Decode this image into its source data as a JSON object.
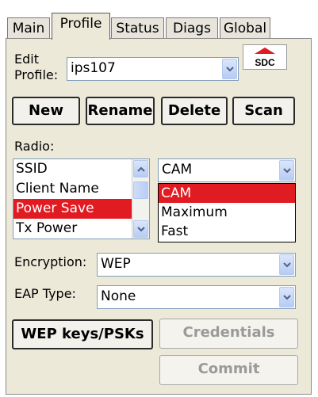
{
  "tabs": [
    "Main",
    "Profile",
    "Status",
    "Diags",
    "Global"
  ],
  "active_tab": "Profile",
  "edit_profile": {
    "label_line1": "Edit",
    "label_line2": "Profile:",
    "value": "ips107"
  },
  "logo": {
    "text": "SDC",
    "color": "#e11b22"
  },
  "buttons": {
    "new": "New",
    "rename": "Rename",
    "delete": "Delete",
    "scan": "Scan"
  },
  "radio": {
    "label": "Radio:",
    "items": [
      "SSID",
      "Client Name",
      "Power Save",
      "Tx Power"
    ],
    "selected_item": "Power Save"
  },
  "power_save": {
    "value": "CAM",
    "options": [
      "CAM",
      "Maximum",
      "Fast"
    ],
    "highlighted": "CAM"
  },
  "encryption": {
    "label": "Encryption:",
    "value": "WEP"
  },
  "eap_type": {
    "label": "EAP Type:",
    "value": "None"
  },
  "actions": {
    "wep_keys": "WEP keys/PSKs",
    "credentials": "Credentials",
    "commit": "Commit"
  },
  "colors": {
    "selection": "#e11b22",
    "panel": "#ece9d8"
  }
}
